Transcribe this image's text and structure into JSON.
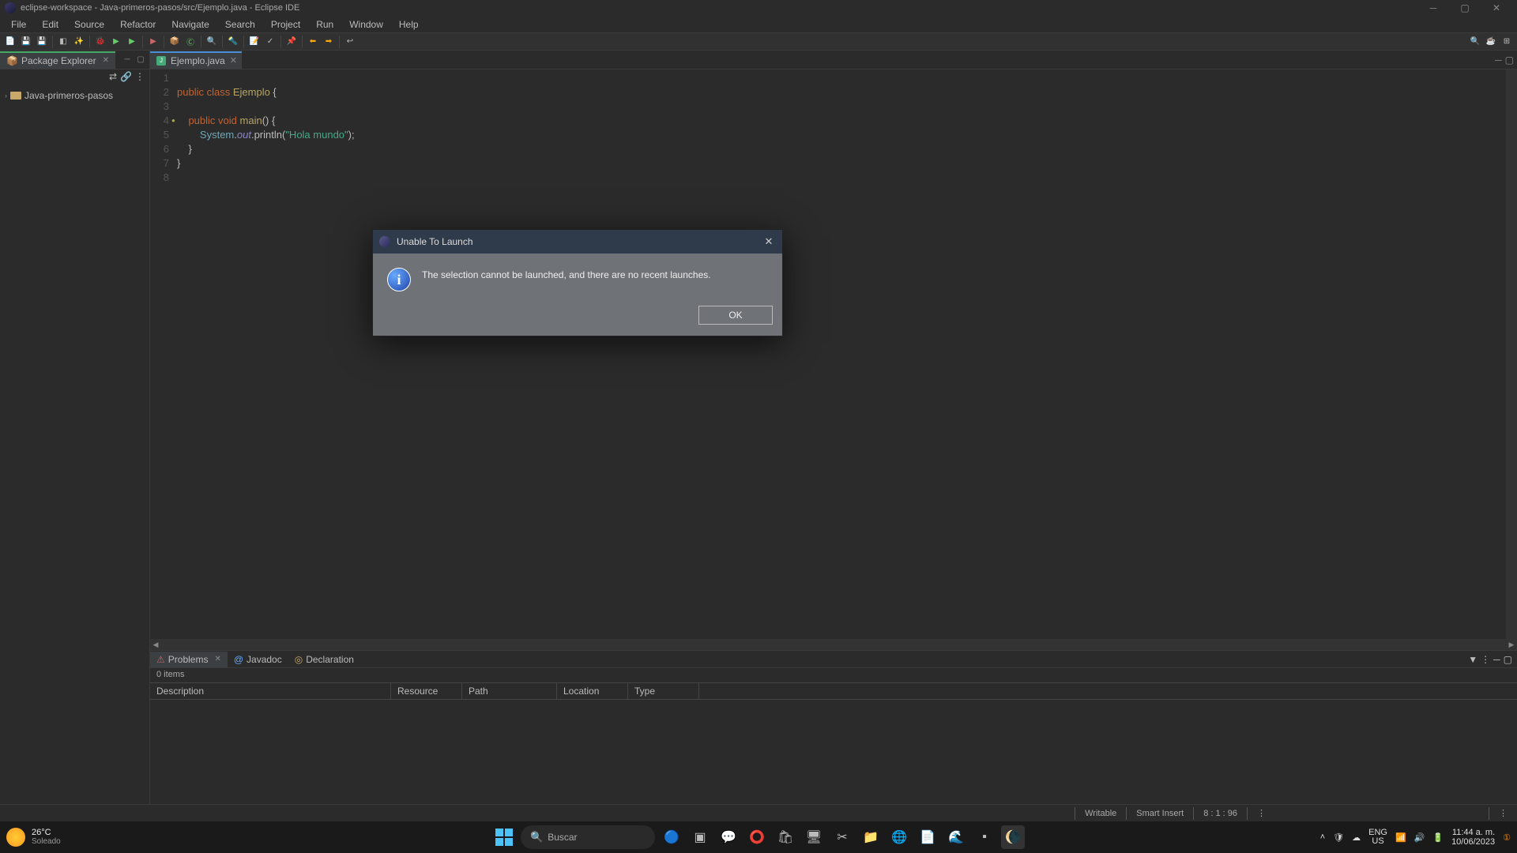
{
  "titlebar": {
    "text": "eclipse-workspace - Java-primeros-pasos/src/Ejemplo.java - Eclipse IDE"
  },
  "menu": [
    "File",
    "Edit",
    "Source",
    "Refactor",
    "Navigate",
    "Search",
    "Project",
    "Run",
    "Window",
    "Help"
  ],
  "sidebar": {
    "title": "Package Explorer",
    "project": "Java-primeros-pasos"
  },
  "editor": {
    "tab": "Ejemplo.java",
    "lines": [
      "1",
      "2",
      "3",
      "4",
      "5",
      "6",
      "7",
      "8"
    ]
  },
  "dialog": {
    "title": "Unable To Launch",
    "message": "The selection cannot be launched, and there are no recent launches.",
    "ok": "OK"
  },
  "bottom": {
    "tabs": [
      "Problems",
      "Javadoc",
      "Declaration"
    ],
    "items_label": "0 items",
    "columns": [
      "Description",
      "Resource",
      "Path",
      "Location",
      "Type"
    ]
  },
  "status": {
    "writable": "Writable",
    "insert": "Smart Insert",
    "pos": "8 : 1 : 96"
  },
  "taskbar": {
    "temp": "26°C",
    "weather": "Soleado",
    "search": "Buscar",
    "lang1": "ENG",
    "lang2": "US",
    "time": "11:44 a. m.",
    "date": "10/06/2023"
  }
}
